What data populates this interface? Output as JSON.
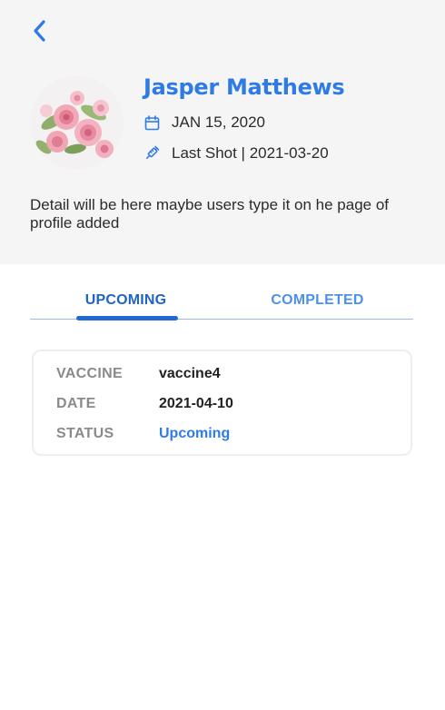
{
  "profile": {
    "name": "Jasper Matthews",
    "birth_date": "JAN 15, 2020",
    "last_shot": "Last Shot | 2021-03-20",
    "description": "Detail will be here maybe users type it on he page of profile added",
    "avatar_icon": "pink-roses-photo"
  },
  "tabs": [
    {
      "label": "UPCOMING",
      "active": true
    },
    {
      "label": "COMPLETED",
      "active": false
    }
  ],
  "appointment": {
    "vaccine_label": "VACCINE",
    "vaccine_value": "vaccine4",
    "date_label": "DATE",
    "date_value": "2021-04-10",
    "status_label": "STATUS",
    "status_value": "Upcoming"
  },
  "icons": {
    "back": "chevron-left-icon",
    "calendar": "calendar-icon",
    "syringe": "syringe-icon"
  },
  "colors": {
    "accent": "#2f7be6",
    "tab_active": "#1f63c6",
    "header_bg": "#f5f5f6"
  }
}
